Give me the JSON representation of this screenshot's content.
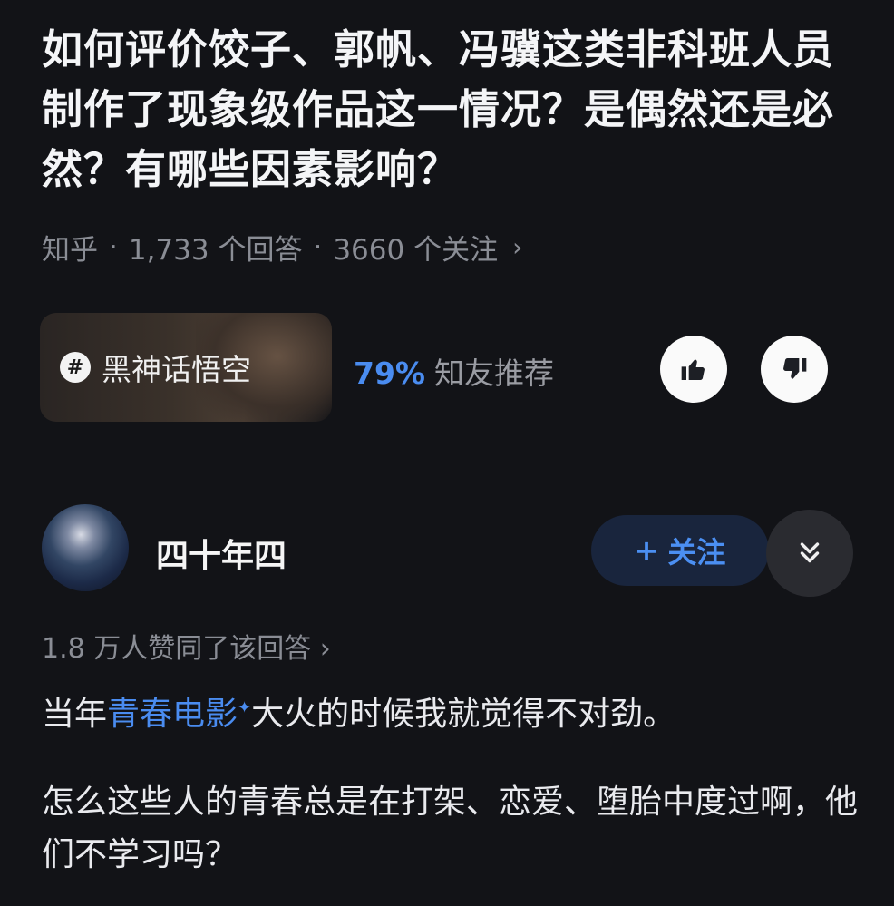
{
  "question": {
    "title": "如何评价饺子、郭帆、冯骥这类非科班人员制作了现象级作品这一情况？是偶然还是必然？有哪些因素影响？",
    "source": "知乎",
    "answers": "1,733 个回答",
    "followers": "3660 个关注",
    "meta_chevron": "›"
  },
  "topic": {
    "hash": "#",
    "name": "黑神话悟空",
    "recommend_pct": "79%",
    "recommend_label": "知友推荐"
  },
  "answer": {
    "author": "四十年四",
    "follow_label": "关注",
    "follow_plus": "+",
    "likes": "1.8 万人赞同了该回答 ›",
    "para1_prefix": "当年",
    "para1_link": "青春电影",
    "para1_spark": "✦",
    "para1_suffix": "大火的时候我就觉得不对劲。",
    "para2": "怎么这些人的青春总是在打架、恋爱、堕胎中度过啊，他们不学习吗？"
  },
  "colors": {
    "background": "#121317",
    "accent": "#4a8cf0",
    "muted": "#8a8d95"
  },
  "icons": [
    "hash-icon",
    "thumbs-up-icon",
    "thumbs-down-icon",
    "double-chevron-down-icon",
    "plus-icon"
  ]
}
